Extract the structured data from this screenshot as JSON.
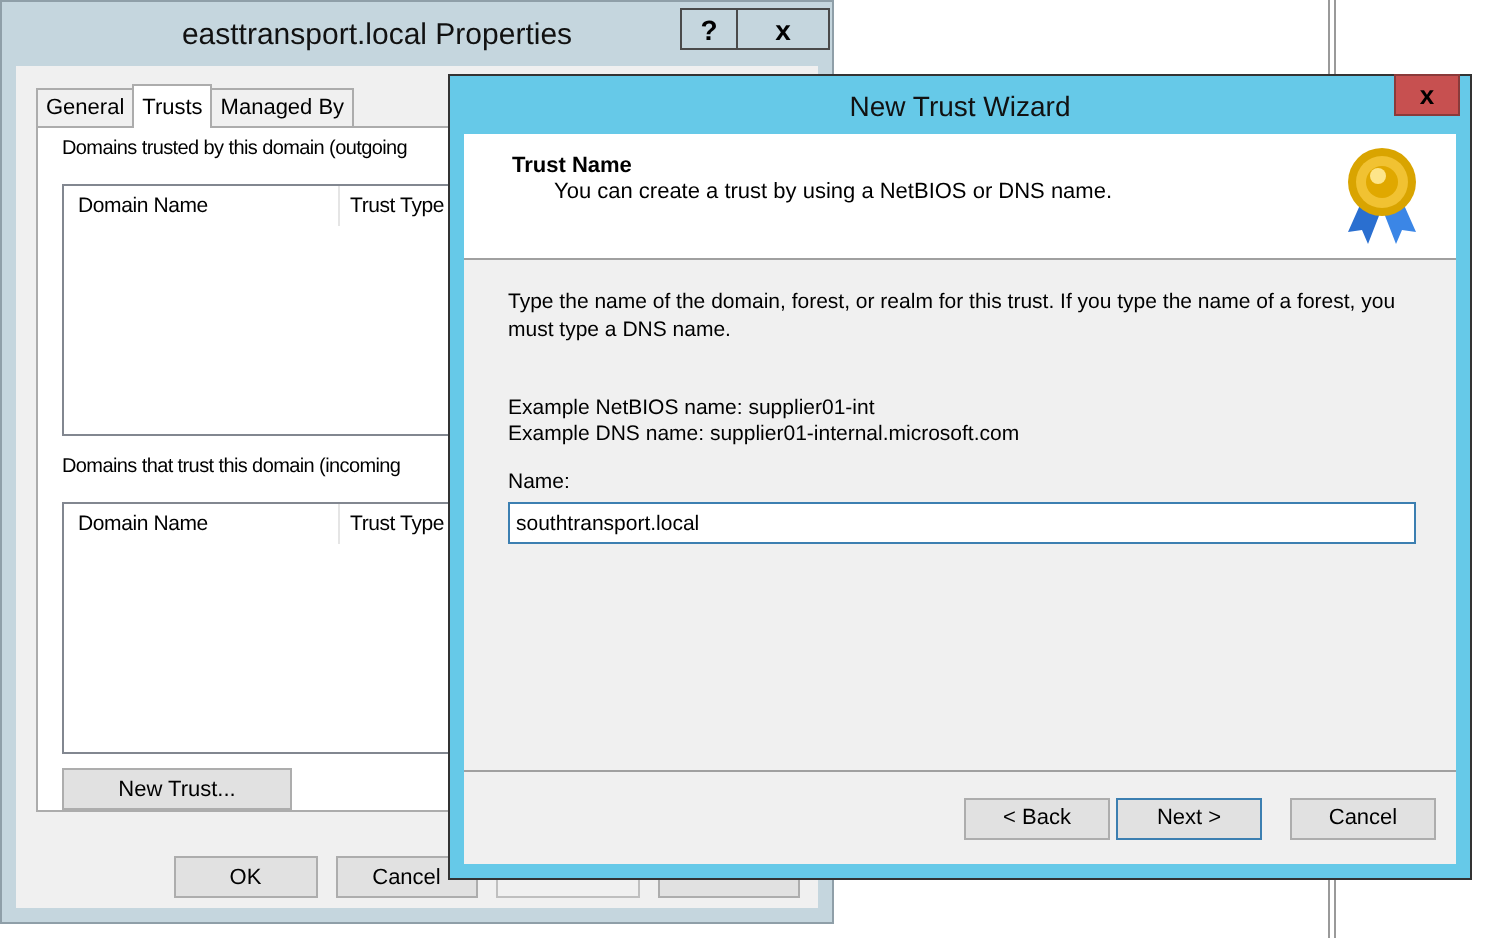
{
  "properties_window": {
    "title": "easttransport.local Properties",
    "help_button": "?",
    "close_button": "x",
    "tabs": [
      {
        "label": "General",
        "selected": false
      },
      {
        "label": "Trusts",
        "selected": true
      },
      {
        "label": "Managed By",
        "selected": false
      }
    ],
    "outgoing_label": "Domains trusted by this domain (outgoing",
    "outgoing_list": {
      "columns": [
        "Domain Name",
        "Trust Type"
      ]
    },
    "incoming_label": "Domains that trust this domain (incoming",
    "incoming_list": {
      "columns": [
        "Domain Name",
        "Trust Type"
      ]
    },
    "new_trust_button": "New Trust...",
    "buttons": [
      {
        "label": "OK",
        "disabled": false
      },
      {
        "label": "Cancel",
        "disabled": false
      },
      {
        "disabled": true
      },
      {
        "disabled": false
      }
    ]
  },
  "wizard": {
    "title": "New Trust Wizard",
    "close_button": "x",
    "header": {
      "title": "Trust Name",
      "subtitle": "You can create a trust by using a NetBIOS or DNS name."
    },
    "instructions": "Type the name of the domain, forest, or realm for this trust. If you type the name of a forest, you must type a DNS name.",
    "examples": [
      "Example NetBIOS name: supplier01-int",
      "Example DNS name: supplier01-internal.microsoft.com"
    ],
    "name_label": "Name:",
    "name_value": "southtransport.local",
    "buttons": [
      {
        "label": "< Back",
        "default": false
      },
      {
        "label": "Next >",
        "default": true
      },
      {
        "label": "Cancel",
        "default": false
      }
    ]
  }
}
